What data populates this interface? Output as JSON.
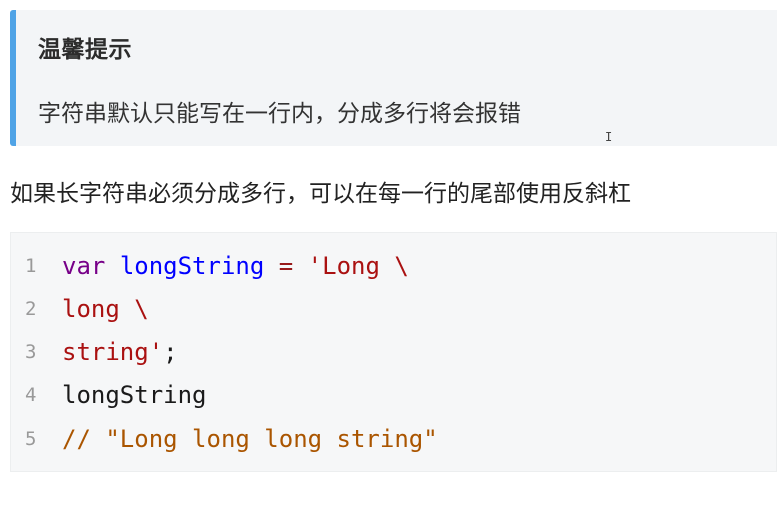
{
  "tip": {
    "title": "温馨提示",
    "body": "字符串默认只能写在一行内，分成多行将会报错"
  },
  "cursor_glyph": "I",
  "paragraph": "如果长字符串必须分成多行，可以在每一行的尾部使用反斜杠",
  "code": {
    "lines": [
      {
        "number": "1",
        "tokens": [
          {
            "text": "var",
            "kind": "kw"
          },
          {
            "text": " ",
            "kind": "plain"
          },
          {
            "text": "longString",
            "kind": "def"
          },
          {
            "text": " ",
            "kind": "plain"
          },
          {
            "text": "=",
            "kind": "op"
          },
          {
            "text": " ",
            "kind": "plain"
          },
          {
            "text": "'Long \\",
            "kind": "str"
          }
        ]
      },
      {
        "number": "2",
        "tokens": [
          {
            "text": "long \\",
            "kind": "str"
          }
        ]
      },
      {
        "number": "3",
        "tokens": [
          {
            "text": "string'",
            "kind": "str"
          },
          {
            "text": ";",
            "kind": "var"
          }
        ]
      },
      {
        "number": "4",
        "tokens": [
          {
            "text": "longString",
            "kind": "var"
          }
        ]
      },
      {
        "number": "5",
        "tokens": [
          {
            "text": "// \"Long long long string\"",
            "kind": "cm"
          }
        ]
      }
    ]
  },
  "colors": {
    "tip_border": "#4fa3e6",
    "tip_background": "#f3f5f7",
    "code_background": "#f6f7f8",
    "keyword": "#770088",
    "definition": "#0000ff",
    "string": "#aa1111",
    "comment": "#aa5500"
  }
}
